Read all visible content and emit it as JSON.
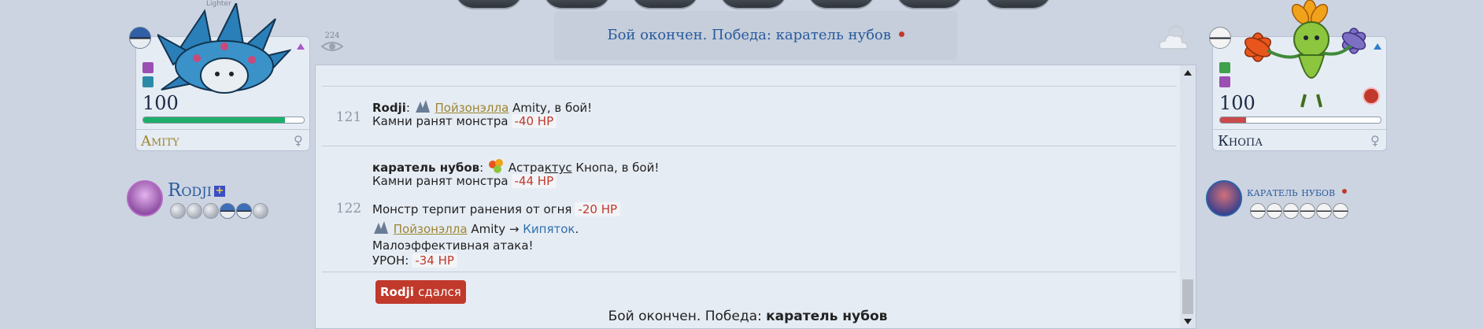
{
  "banner": {
    "text": "Бой окончен. Победа: каратель нубов"
  },
  "views": "224",
  "left": {
    "pokemon": {
      "name": "Amity",
      "level": "100",
      "hp_fraction": 0.88,
      "hp_color": "#1fae6a",
      "caption": "Lighter"
    },
    "player": {
      "name": "Rodji",
      "party": [
        "grey",
        "grey",
        "grey",
        "blue",
        "blue",
        "grey"
      ]
    }
  },
  "right": {
    "pokemon": {
      "name": "Кнопа",
      "level": "100",
      "hp_fraction": 0.16,
      "hp_color": "#c94a4a"
    },
    "player": {
      "name": "каратель нубов",
      "party": [
        "white",
        "white",
        "white",
        "white",
        "white",
        "white"
      ]
    }
  },
  "log": {
    "turns": [
      {
        "number": "121",
        "speaker": "Rodji",
        "send_link": "Пойзонэлла",
        "send_rest": " Amity, в бой!",
        "damage_text": "Камни ранят монстра",
        "damage": "-40 HP"
      },
      {
        "number": "122",
        "speaker": "каратель нубов",
        "send_pre": "Астра",
        "send_under": "ктус",
        "send_rest": " Кнопа, в бой!",
        "damage_text": "Камни ранят монстра",
        "damage": "-44 HP",
        "burn_text": "Монстр терпит ранения от огня",
        "burn_damage": "-20 HP",
        "attacker_link": "Пойзонэлла",
        "attacker_name": "Amity",
        "arrow": "→",
        "move": "Кипяток",
        "effect": "Малоэффективная атака!",
        "uron_label": "УРОН:",
        "uron": "-34 HP"
      }
    ],
    "surrender_name": "Rodji",
    "surrender_text": "сдался",
    "final_prefix": "Бой окончен. Победа: ",
    "final_winner": "каратель нубов"
  }
}
